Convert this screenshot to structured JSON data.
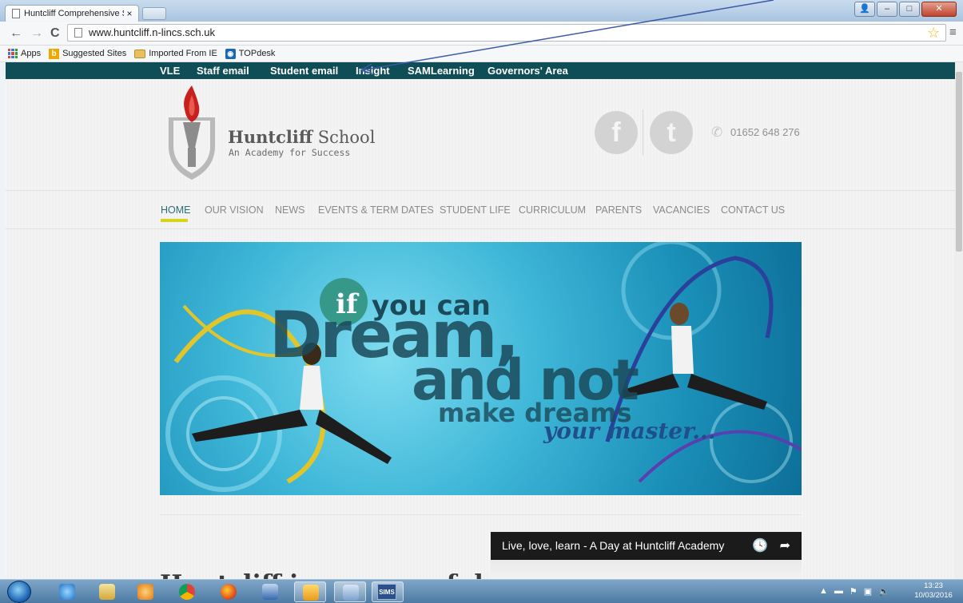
{
  "browser": {
    "tab_title": "Huntcliff Comprehensive S",
    "tab_close": "×",
    "url": "www.huntcliff.n-lincs.sch.uk",
    "back": "←",
    "forward": "→",
    "reload": "C",
    "star": "☆",
    "menu": "≡",
    "bookmarks": [
      {
        "label": "Apps",
        "icon": "apps-grid-icon"
      },
      {
        "label": "Suggested Sites",
        "icon": "bing-icon"
      },
      {
        "label": "Imported From IE",
        "icon": "folder-icon"
      },
      {
        "label": "TOPdesk",
        "icon": "topdesk-icon"
      }
    ]
  },
  "site": {
    "quick_links": [
      "VLE",
      "Staff email",
      "Student email",
      "Insight",
      "SAMLearning",
      "Governors' Area"
    ],
    "brand": {
      "name_bold": "Huntcliff",
      "name_rest": " School",
      "tagline": "An Academy for Success"
    },
    "social": {
      "facebook": "f",
      "twitter": "t"
    },
    "phone": "01652 648 276",
    "nav": [
      "HOME",
      "OUR VISION",
      "NEWS",
      "EVENTS & TERM DATES",
      "STUDENT LIFE",
      "CURRICULUM",
      "PARENTS",
      "VACANCIES",
      "CONTACT US"
    ],
    "nav_active": "HOME",
    "banner": {
      "line1_a": "if",
      "line1_b": "you can",
      "line2": "Dream,",
      "line3": "and not",
      "line4": "make dreams",
      "line5": "your master..."
    },
    "video_title": "Live, love, learn - A Day at Huntcliff Academy",
    "heading_peek": "Huntcliff is a successful"
  },
  "taskbar": {
    "time": "13:23",
    "date": "10/03/2016",
    "sims_label": "SIMS",
    "items": [
      "internet-explorer-icon",
      "file-explorer-icon",
      "media-player-icon",
      "chrome-icon",
      "firefox-icon",
      "network-icon",
      "outlook-icon",
      "users-icon",
      "sims-icon"
    ]
  },
  "colors": {
    "quick_links_bg": "#0f4d57",
    "nav_active": "#2d6d78",
    "nav_underline": "#d7d41c",
    "banner_text": "#1b4a5a",
    "annotation_arrow": "#3b5aa8"
  }
}
